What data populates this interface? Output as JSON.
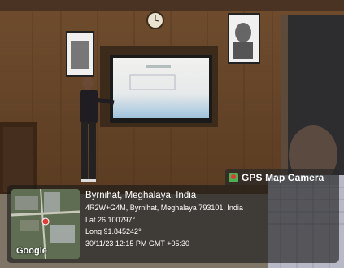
{
  "overlay": {
    "app_name": "GPS Map Camera",
    "location_title": "Byrnihat, Meghalaya, India",
    "address": "4R2W+G4M, Byrnihat, Meghalaya 793101, India",
    "latitude": "Lat 26.100797°",
    "longitude": "Long 91.845242°",
    "timestamp": "30/11/23 12:15 PM GMT +05:30",
    "map_brand": "Google"
  },
  "colors": {
    "wall": "#7a5634",
    "panel_bg": "#1e1e1e",
    "badge_accent": "#4caf50"
  }
}
